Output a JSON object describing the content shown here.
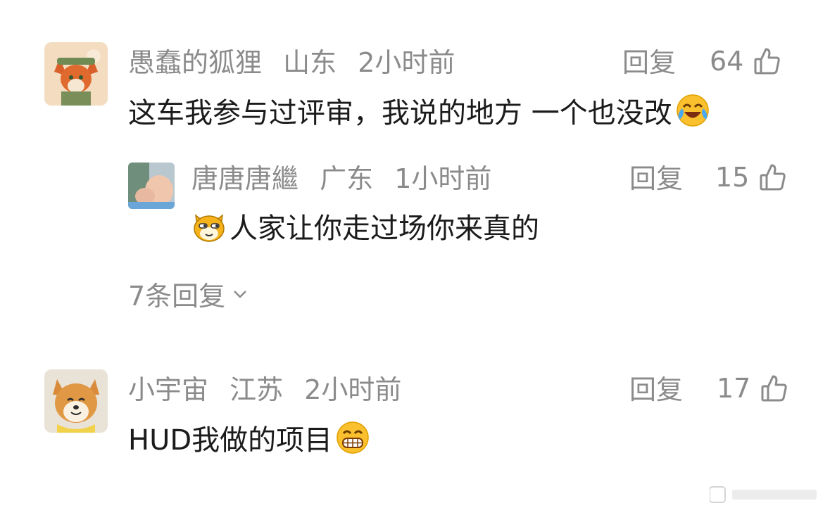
{
  "comments": [
    {
      "username": "愚蠢的狐狸",
      "location": "山东",
      "time": "2小时前",
      "text": "这车我参与过评审，我说的地方 一个也没改",
      "reply_label": "回复",
      "likes": "64",
      "emoji": "laughing-crying-emoji",
      "replies": [
        {
          "username": "唐唐唐繼",
          "location": "广东",
          "time": "1小时前",
          "text": "人家让你走过场你来真的",
          "reply_label": "回复",
          "likes": "15",
          "emoji": "smug-cat-emoji"
        }
      ],
      "more_replies": "7条回复"
    },
    {
      "username": "小宇宙",
      "location": "江苏",
      "time": "2小时前",
      "text": "HUD我做的项目",
      "reply_label": "回复",
      "likes": "17",
      "emoji": "grinning-emoji"
    }
  ],
  "colors": {
    "meta": "#8b8b8b",
    "text": "#1b1b1b",
    "background": "#ffffff"
  }
}
